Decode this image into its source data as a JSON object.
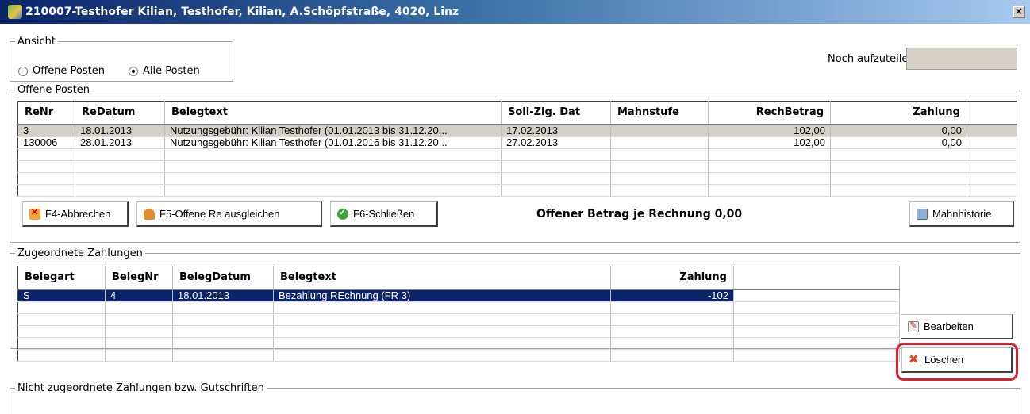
{
  "window": {
    "title": "210007-Testhofer Kilian, Testhofer, Kilian, A.Schöpfstraße, 4020, Linz",
    "close_label": "×"
  },
  "ansicht": {
    "legend": "Ansicht",
    "options": [
      {
        "label": "Offene Posten",
        "checked": false
      },
      {
        "label": "Alle Posten",
        "checked": true
      }
    ],
    "noch_label": "Noch aufzuteilen"
  },
  "offene_posten": {
    "legend": "Offene Posten",
    "columns": [
      "ReNr",
      "ReDatum",
      "Belegtext",
      "Soll-Zlg. Dat",
      "Mahnstufe",
      "RechBetrag",
      "Zahlung"
    ],
    "rows": [
      [
        "3",
        "18.01.2013",
        "Nutzungsgebühr: Kilian Testhofer (01.01.2013 bis 31.12.20...",
        "17.02.2013",
        "",
        "102,00",
        "0,00"
      ],
      [
        "130006",
        "28.01.2013",
        "Nutzungsgebühr: Kilian Testhofer (01.01.2016 bis 31.12.20...",
        "27.02.2013",
        "",
        "102,00",
        "0,00"
      ]
    ],
    "buttons": {
      "cancel": "F4-Abbrechen",
      "settle": "F5-Offene Re ausgleichen",
      "close": "F6-Schließen",
      "history": "Mahnhistorie"
    },
    "open_amount_text": "Offener Betrag je Rechnung 0,00"
  },
  "zugeordnete": {
    "legend": "Zugeordnete Zahlungen",
    "columns": [
      "Belegart",
      "BelegNr",
      "BelegDatum",
      "Belegtext",
      "Zahlung"
    ],
    "rows": [
      [
        "S",
        "4",
        "18.01.2013",
        "Bezahlung REchnung (FR 3)",
        "-102"
      ]
    ],
    "buttons": {
      "edit": "Bearbeiten",
      "delete": "Löschen"
    }
  },
  "nicht_zugeordnete": {
    "legend": "Nicht zugeordnete Zahlungen bzw. Gutschriften"
  },
  "colors": {
    "selection": "#0a246a",
    "highlight": "#e0202a"
  }
}
